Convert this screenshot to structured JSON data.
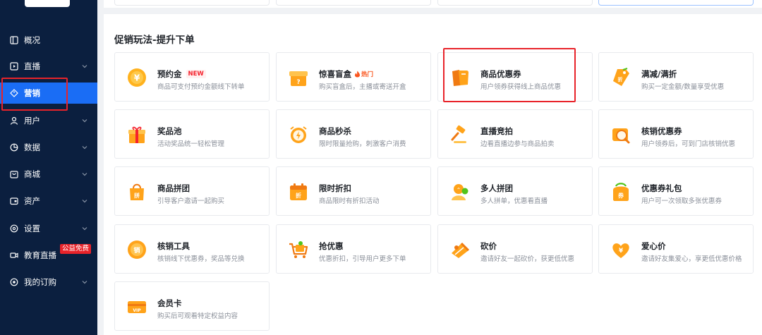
{
  "sidebar": {
    "items": [
      {
        "label": "概况",
        "icon": "overview-icon"
      },
      {
        "label": "直播",
        "icon": "live-icon"
      },
      {
        "label": "营销",
        "icon": "marketing-icon",
        "active": true
      },
      {
        "label": "用户",
        "icon": "user-icon"
      },
      {
        "label": "数据",
        "icon": "data-icon"
      },
      {
        "label": "商城",
        "icon": "mall-icon"
      },
      {
        "label": "资产",
        "icon": "asset-icon"
      },
      {
        "label": "设置",
        "icon": "settings-icon"
      },
      {
        "label": "教育直播",
        "icon": "edu-live-icon",
        "badge": "公益免费"
      },
      {
        "label": "我的订购",
        "icon": "subscription-icon"
      }
    ]
  },
  "main": {
    "section_title": "促销玩法-提升下单",
    "cards": [
      {
        "title": "预约金",
        "tag": "NEW",
        "desc": "商品可支付预约金额线下转单",
        "icon": "deposit-coin-icon"
      },
      {
        "title": "惊喜盲盒",
        "tag": "热门",
        "desc": "购买盲盒后，主播或寄送开盒",
        "icon": "blind-box-icon"
      },
      {
        "title": "商品优惠券",
        "desc": "用户领券获得线上商品优惠",
        "icon": "coupon-icon"
      },
      {
        "title": "满减/满折",
        "desc": "购买一定金额/数量享受优惠",
        "icon": "discount-tag-icon"
      },
      {
        "title": "奖品池",
        "desc": "活动奖品统一轻松管理",
        "icon": "gift-icon"
      },
      {
        "title": "商品秒杀",
        "desc": "限时限量抢购，刺激客户消费",
        "icon": "flash-sale-icon"
      },
      {
        "title": "直播竞拍",
        "desc": "边看直播边参与商品拍卖",
        "icon": "auction-hammer-icon"
      },
      {
        "title": "核销优惠券",
        "desc": "用户领券后，可到门店核销优惠",
        "icon": "verify-coupon-icon"
      },
      {
        "title": "商品拼团",
        "desc": "引导客户邀请一起购买",
        "icon": "group-buy-icon"
      },
      {
        "title": "限时折扣",
        "desc": "商品限时有折扣活动",
        "icon": "time-discount-icon"
      },
      {
        "title": "多人拼团",
        "desc": "多人拼单，优惠看直播",
        "icon": "multi-group-icon"
      },
      {
        "title": "优惠券礼包",
        "desc": "用户可一次领取多张优惠券",
        "icon": "coupon-pack-icon"
      },
      {
        "title": "核销工具",
        "desc": "核销线下优惠券，奖品等兑换",
        "icon": "verify-tool-icon"
      },
      {
        "title": "抢优惠",
        "desc": "优惠折扣，引导用户更多下单",
        "icon": "grab-cart-icon"
      },
      {
        "title": "砍价",
        "desc": "邀请好友一起砍价，获更低优惠",
        "icon": "bargain-icon"
      },
      {
        "title": "爱心价",
        "desc": "邀请好友集爱心，享更低优惠价格",
        "icon": "love-price-icon"
      },
      {
        "title": "会员卡",
        "desc": "购买后可观看特定权益内容",
        "icon": "vip-card-icon"
      }
    ]
  },
  "colors": {
    "sidebar_bg": "#0b1f3f",
    "active": "#1a6df5",
    "highlight": "#e8232a",
    "icon_orange": "#ffa31a"
  }
}
